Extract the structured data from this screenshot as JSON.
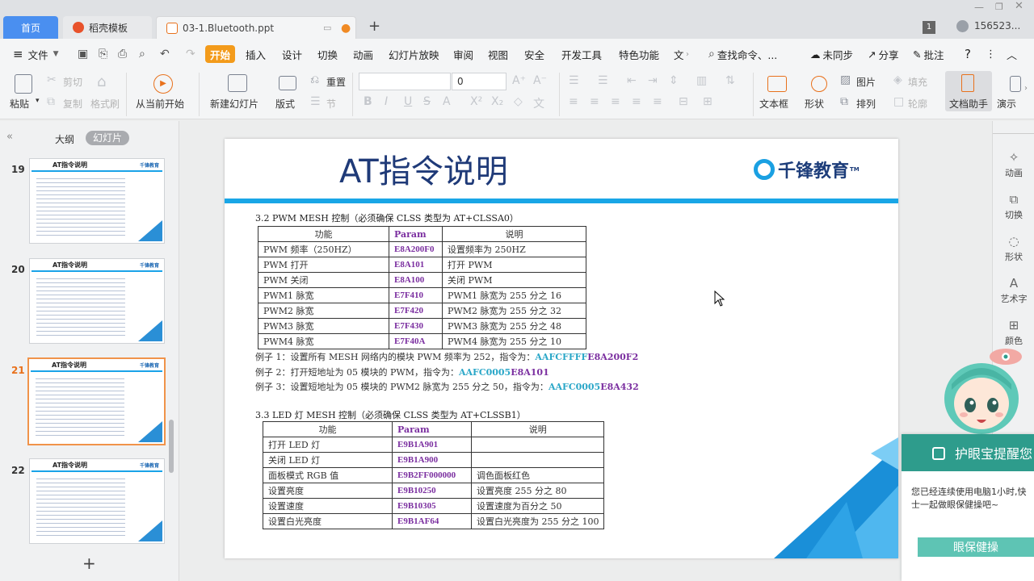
{
  "titlebar": {
    "tabs": [
      {
        "label": "首页"
      },
      {
        "label": "稻壳模板"
      },
      {
        "label": "03-1.Bluetooth.ppt"
      }
    ],
    "add_tab": "+",
    "badge": "1",
    "user": "156523..."
  },
  "menu": {
    "file": "文件",
    "items": [
      "开始",
      "插入",
      "设计",
      "切换",
      "动画",
      "幻灯片放映",
      "审阅",
      "视图",
      "安全",
      "开发工具",
      "特色功能",
      "文"
    ],
    "search": "查找命令、...",
    "sync": "未同步",
    "share": "分享",
    "annotate": "批注",
    "help": "?"
  },
  "ribbon": {
    "paste": "粘贴",
    "cut": "剪切",
    "copy": "复制",
    "format_painter": "格式刷",
    "play_from_current": "从当前开始",
    "new_slide": "新建幻灯片",
    "layout": "版式",
    "reset": "重置",
    "section": "节",
    "font_size": "0",
    "text_box": "文本框",
    "shape": "形状",
    "picture": "图片",
    "arrange": "排列",
    "fill": "填充",
    "outline": "轮廓",
    "doc_helper": "文档助手",
    "present": "演示"
  },
  "leftpanel": {
    "tab_outline": "大纲",
    "tab_slides": "幻灯片",
    "thumb_title": "AT指令说明",
    "thumb_logo": "千锋教育",
    "slides": [
      {
        "num": "19"
      },
      {
        "num": "20"
      },
      {
        "num": "21"
      },
      {
        "num": "22"
      }
    ],
    "add": "+"
  },
  "slide": {
    "title": "AT指令说明",
    "logo": "千锋教育",
    "section1": "3.2 PWM MESH 控制（必须确保 CLSS 类型为 AT+CLSSA0）",
    "table1_head": [
      "功能",
      "Param",
      "说明"
    ],
    "table1": [
      [
        "PWM 频率（250HZ）",
        "E8A200F0",
        "设置频率为 250HZ"
      ],
      [
        "PWM 打开",
        "E8A101",
        "打开 PWM"
      ],
      [
        "PWM 关闭",
        "E8A100",
        "关闭 PWM"
      ],
      [
        "PWM1 脉宽",
        "E7F410",
        "PWM1 脉宽为 255 分之 16"
      ],
      [
        "PWM2 脉宽",
        "E7F420",
        "PWM2 脉宽为 255 分之 32"
      ],
      [
        "PWM3 脉宽",
        "E7F430",
        "PWM3 脉宽为 255 分之 48"
      ],
      [
        "PWM4 脉宽",
        "E7F40A",
        "PWM4 脉宽为 255 分之 10"
      ]
    ],
    "ex1_text": "例子 1：设置所有 MESH 网络内的模块 PWM 频率为 252，指令为：",
    "ex1_a": "AAFCFFFF",
    "ex1_b": "E8A200F2",
    "ex2_text": "例子 2：打开短地址为 05 模块的 PWM，指令为：",
    "ex2_a": "AAFC0005",
    "ex2_b": "E8A101",
    "ex3_text": "例子 3：设置短地址为 05 模块的 PWM2 脉宽为 255 分之 50，指令为：",
    "ex3_a": "AAFC0005",
    "ex3_b": "E8A432",
    "section2": "3.3 LED 灯 MESH 控制（必须确保 CLSS 类型为 AT+CLSSB1）",
    "table2_head": [
      "功能",
      "Param",
      "说明"
    ],
    "table2": [
      [
        "打开 LED 灯",
        "E9B1A901",
        ""
      ],
      [
        "关闭 LED 灯",
        "E9B1A900",
        ""
      ],
      [
        "面板模式 RGB 值",
        "E9B2FF000000",
        "调色面板红色"
      ],
      [
        "设置亮度",
        "E9B10250",
        "设置亮度 255 分之 80"
      ],
      [
        "设置速度",
        "E9B10305",
        "设置速度为百分之 50"
      ],
      [
        "设置白光亮度",
        "E9B1AF64",
        "设置白光亮度为 255 分之 100"
      ]
    ]
  },
  "rightpanel": {
    "items": [
      "动画",
      "切换",
      "形状",
      "艺术字",
      "颜色"
    ]
  },
  "popup": {
    "title": "护眼宝提醒您",
    "body": "您已经连续使用电脑1小时,快士一起做眼保健操吧~",
    "button": "眼保健操"
  }
}
